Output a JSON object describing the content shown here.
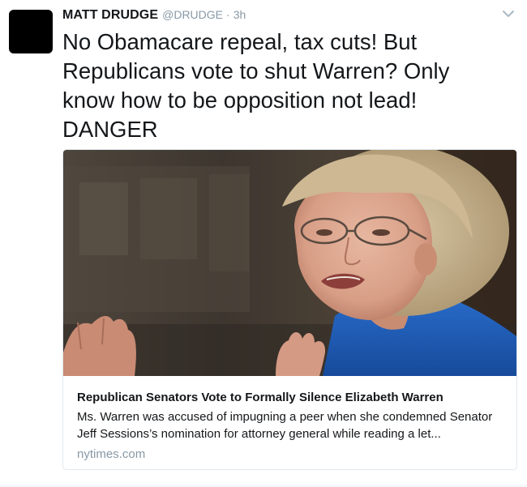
{
  "tweet": {
    "author_name": "MATT DRUDGE",
    "handle": "@DRUDGE",
    "separator": "·",
    "timestamp": "3h",
    "text": "No Obamacare repeal, tax cuts! But\nRepublicans vote to shut Warren? Only\nknow how to be opposition not lead!\nDANGER",
    "avatar_icon": "avatar-black-square",
    "menu_icon": "chevron-down-icon"
  },
  "card": {
    "image_description_icon": "article-photo",
    "title": "Republican Senators Vote to Formally Silence Elizabeth Warren",
    "description": "Ms. Warren was accused of impugning a peer when she condemned Senator Jeff Sessions’s nomination for attorney general while reading a let...",
    "domain": "nytimes.com"
  },
  "colors": {
    "text_primary": "#14171a",
    "text_secondary": "#8899a6",
    "card_border": "#e1e8ed",
    "jacket_blue": "#1f5fb8"
  }
}
